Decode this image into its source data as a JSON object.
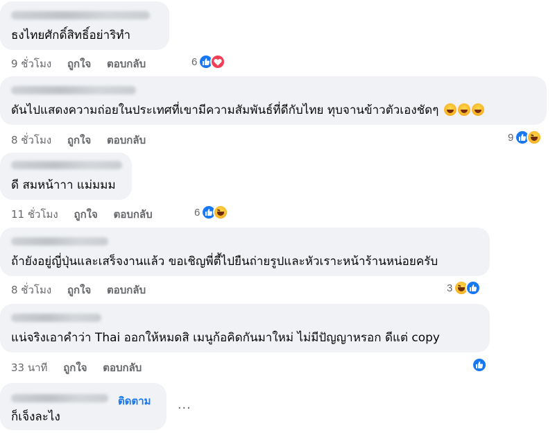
{
  "comments": [
    {
      "text": "ธงไทยศักดิ์สิทธิ์อย่าริทำ",
      "time": "9 ชั่วโมง",
      "like": "ถูกใจ",
      "reply": "ตอบกลับ",
      "reaction_count": "6",
      "reactions": [
        "like-icon",
        "love-icon"
      ]
    },
    {
      "text": "ดันไปแสดงความถ่อยในประเทศที่เขามีความสัมพันธ์ที่ดีกับไทย ทุบจานข้าวตัวเองชัดๆ",
      "time": "8 ชั่วโมง",
      "like": "ถูกใจ",
      "reply": "ตอบกลับ",
      "reaction_count": "9",
      "reactions": [
        "like-icon",
        "haha-icon"
      ]
    },
    {
      "text": "ดี สมหน้าาา แม่มมม",
      "time": "11 ชั่วโมง",
      "like": "ถูกใจ",
      "reply": "ตอบกลับ",
      "reaction_count": "6",
      "reactions": [
        "like-icon",
        "haha-icon"
      ]
    },
    {
      "text": "ถ้ายังอยู่ญี่ปุ่นและเสร็จงานแล้ว ขอเชิญพี่ตี้ไปยืนถ่ายรูปและหัวเราะหน้าร้านหน่อยครับ",
      "time": "8 ชั่วโมง",
      "like": "ถูกใจ",
      "reply": "ตอบกลับ",
      "reaction_count": "3",
      "reactions": [
        "haha-icon",
        "like-icon"
      ]
    },
    {
      "text": "แน่จริงเอาคำว่า Thai ออกให้หมดสิ เมนูก้อคิดกันมาใหม่ ไม่มีปัญญาหรอก ดีแต่ copy",
      "time": "33 นาที",
      "like": "ถูกใจ",
      "reply": "ตอบกลับ",
      "reaction_count": "",
      "reactions": [
        "like-icon"
      ]
    },
    {
      "text": "ก็เจ็งละไง",
      "follow": "ติดตาม",
      "more": "..."
    }
  ],
  "colors": {
    "bubble": "#f0f2f5",
    "meta": "#65676b",
    "link": "#1877f2",
    "like": "#1877f2",
    "love": "#f33e58"
  }
}
